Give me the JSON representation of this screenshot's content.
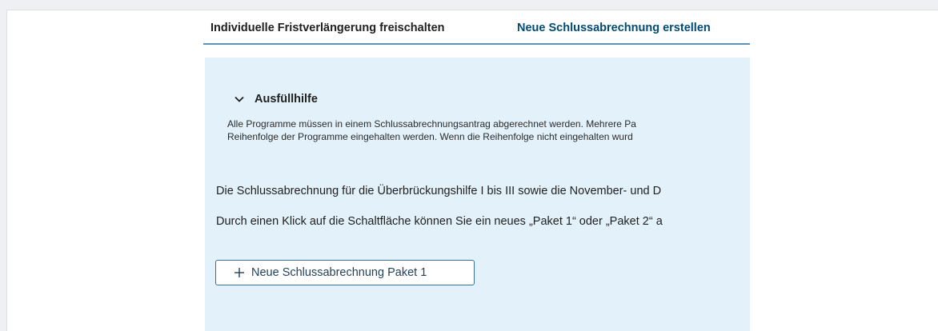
{
  "tabs": {
    "unlock_label": "Individuelle Fristverlängerung freischalten",
    "new_label": "Neue Schlussabrechnung erstellen"
  },
  "helper": {
    "title": "Ausfüllhilfe",
    "icon": "chevron-down-icon",
    "line1": "Alle Programme müssen in einem Schlussabrechnungsantrag abgerechnet werden. Mehrere Pa",
    "line2": "Reihenfolge der Programme eingehalten werden. Wenn die Reihenfolge nicht eingehalten wurd"
  },
  "main": {
    "paragraph1": "Die Schlussabrechnung für die Überbrückungshilfe I bis III sowie die November- und D",
    "paragraph2": "Durch einen Klick auf die Schaltfläche können Sie ein neues „Paket 1“ oder „Paket 2“ a",
    "button": {
      "label": "Neue Schlussabrechnung Paket 1",
      "icon": "plus-icon"
    }
  },
  "colors": {
    "panel_bg": "#e3f2fa",
    "link": "#004b76",
    "tab_underline": "#5e94b6",
    "button_border": "#3a6f95"
  }
}
